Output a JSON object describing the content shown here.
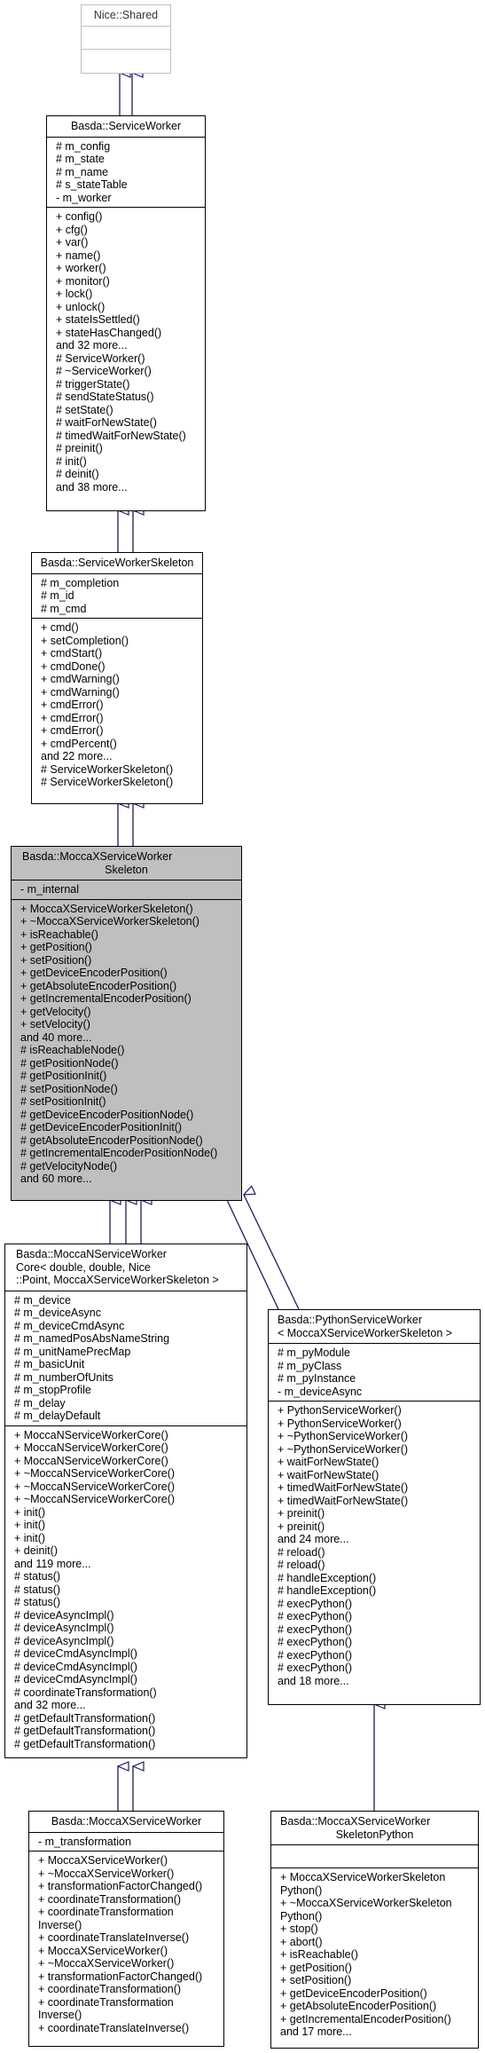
{
  "classes": {
    "nice_shared": {
      "title": "Nice::Shared",
      "attributes": [],
      "methods": []
    },
    "service_worker": {
      "title": "Basda::ServiceWorker",
      "attributes": [
        "# m_config",
        "# m_state",
        "# m_name",
        "# s_stateTable",
        "- m_worker"
      ],
      "methods": [
        "+ config()",
        "+ cfg()",
        "+ var()",
        "+ name()",
        "+ worker()",
        "+ monitor()",
        "+ lock()",
        "+ unlock()",
        "+ stateIsSettled()",
        "+ stateHasChanged()",
        "and 32 more...",
        "# ServiceWorker()",
        "# ~ServiceWorker()",
        "# triggerState()",
        "# sendStateStatus()",
        "# setState()",
        "# waitForNewState()",
        "# timedWaitForNewState()",
        "# preinit()",
        "# init()",
        "# deinit()",
        "and 38 more..."
      ]
    },
    "service_worker_skeleton": {
      "title": "Basda::ServiceWorkerSkeleton",
      "attributes": [
        "# m_completion",
        "# m_id",
        "# m_cmd"
      ],
      "methods": [
        "+ cmd()",
        "+ setCompletion()",
        "+ cmdStart()",
        "+ cmdDone()",
        "+ cmdWarning()",
        "+ cmdWarning()",
        "+ cmdError()",
        "+ cmdError()",
        "+ cmdError()",
        "+ cmdPercent()",
        "and 22 more...",
        "# ServiceWorkerSkeleton()",
        "# ServiceWorkerSkeleton()"
      ]
    },
    "moccax_skeleton": {
      "title_line1": "Basda::MoccaXServiceWorker",
      "title_line2": "Skeleton",
      "attributes": [
        "- m_internal"
      ],
      "methods": [
        "+ MoccaXServiceWorkerSkeleton()",
        "+ ~MoccaXServiceWorkerSkeleton()",
        "+ isReachable()",
        "+ getPosition()",
        "+ setPosition()",
        "+ getDeviceEncoderPosition()",
        "+ getAbsoluteEncoderPosition()",
        "+ getIncrementalEncoderPosition()",
        "+ getVelocity()",
        "+ setVelocity()",
        "and 40 more...",
        "# isReachableNode()",
        "# getPositionNode()",
        "# getPositionInit()",
        "# setPositionNode()",
        "# setPositionInit()",
        "# getDeviceEncoderPositionNode()",
        "# getDeviceEncoderPositionInit()",
        "# getAbsoluteEncoderPositionNode()",
        "# getIncrementalEncoderPositionNode()",
        "# getVelocityNode()",
        "and 60 more..."
      ]
    },
    "mocca_n_core": {
      "title_line1": "Basda::MoccaNServiceWorker",
      "title_line2": "Core< double, double, Nice",
      "title_line3": "::Point, MoccaXServiceWorkerSkeleton >",
      "attributes": [
        "# m_device",
        "# m_deviceAsync",
        "# m_deviceCmdAsync",
        "# m_namedPosAbsNameString",
        "# m_unitNamePrecMap",
        "# m_basicUnit",
        "# m_numberOfUnits",
        "# m_stopProfile",
        "# m_delay",
        "# m_delayDefault"
      ],
      "methods": [
        "+ MoccaNServiceWorkerCore()",
        "+ MoccaNServiceWorkerCore()",
        "+ MoccaNServiceWorkerCore()",
        "+ ~MoccaNServiceWorkerCore()",
        "+ ~MoccaNServiceWorkerCore()",
        "+ ~MoccaNServiceWorkerCore()",
        "+ init()",
        "+ init()",
        "+ init()",
        "+ deinit()",
        "and 119 more...",
        "# status()",
        "# status()",
        "# status()",
        "# deviceAsyncImpl()",
        "# deviceAsyncImpl()",
        "# deviceAsyncImpl()",
        "# deviceCmdAsyncImpl()",
        "# deviceCmdAsyncImpl()",
        "# deviceCmdAsyncImpl()",
        "# coordinateTransformation()",
        "and 32 more...",
        "# getDefaultTransformation()",
        "# getDefaultTransformation()",
        "# getDefaultTransformation()"
      ]
    },
    "python_worker": {
      "title_line1": "Basda::PythonServiceWorker",
      "title_line2": "< MoccaXServiceWorkerSkeleton >",
      "attributes": [
        "# m_pyModule",
        "# m_pyClass",
        "# m_pyInstance",
        "- m_deviceAsync"
      ],
      "methods": [
        "+ PythonServiceWorker()",
        "+ PythonServiceWorker()",
        "+ ~PythonServiceWorker()",
        "+ ~PythonServiceWorker()",
        "+ waitForNewState()",
        "+ waitForNewState()",
        "+ timedWaitForNewState()",
        "+ timedWaitForNewState()",
        "+ preinit()",
        "+ preinit()",
        "and 24 more...",
        "# reload()",
        "# reload()",
        "# handleException()",
        "# handleException()",
        "# execPython()",
        "# execPython()",
        "# execPython()",
        "# execPython()",
        "# execPython()",
        "# execPython()",
        "and 18 more..."
      ]
    },
    "moccax_worker": {
      "title": "Basda::MoccaXServiceWorker",
      "attributes": [
        "- m_transformation"
      ],
      "methods": [
        "+ MoccaXServiceWorker()",
        "+ ~MoccaXServiceWorker()",
        "+ transformationFactorChanged()",
        "+ coordinateTransformation()",
        "+ coordinateTransformation Inverse()",
        "+ coordinateTranslateInverse()",
        "+ MoccaXServiceWorker()",
        "+ ~MoccaXServiceWorker()",
        "+ transformationFactorChanged()",
        "+ coordinateTransformation()",
        "+ coordinateTransformation Inverse()",
        "+ coordinateTranslateInverse()"
      ]
    },
    "moccax_skeleton_python": {
      "title_line1": "Basda::MoccaXServiceWorker",
      "title_line2": "SkeletonPython",
      "attributes": [],
      "methods": [
        "+ MoccaXServiceWorkerSkeleton Python()",
        "+ ~MoccaXServiceWorkerSkeleton Python()",
        "+ stop()",
        "+ abort()",
        "+ isReachable()",
        "+ getPosition()",
        "+ setPosition()",
        "+ getDeviceEncoderPosition()",
        "+ getAbsoluteEncoderPosition()",
        "+ getIncrementalEncoderPosition()",
        "and 17 more..."
      ]
    }
  },
  "colors": {
    "edge": "#191970",
    "focus_fill": "#bfbfbf",
    "external_border": "#bfbfbf"
  }
}
